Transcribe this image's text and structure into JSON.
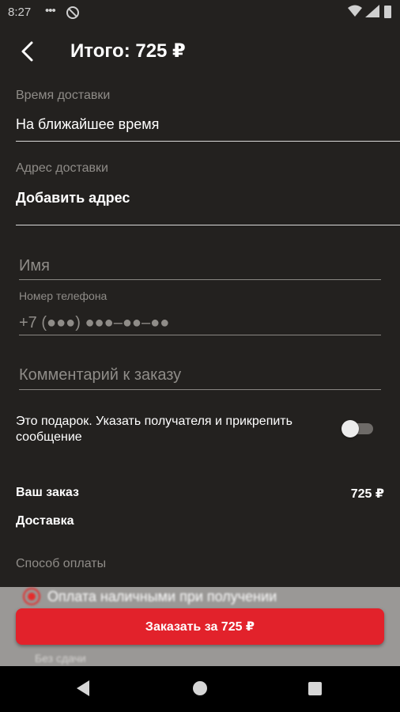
{
  "status_bar": {
    "time": "8:27",
    "dots": "•••",
    "icons": [
      "do-not-disturb-icon",
      "wifi-icon",
      "signal-icon",
      "battery-icon"
    ]
  },
  "header": {
    "title": "Итого: 725 ₽",
    "back_icon": "chevron-left-icon"
  },
  "delivery_time": {
    "label": "Время доставки",
    "value": "На ближайшее время"
  },
  "delivery_address": {
    "label": "Адрес доставки",
    "action": "Добавить адрес"
  },
  "form": {
    "name_placeholder": "Имя",
    "phone_label": "Номер телефона",
    "phone_placeholder": "+7 (●●●) ●●●–●●–●●",
    "comment_placeholder": "Комментарий к заказу"
  },
  "gift": {
    "text": "Это подарок. Указать получателя и прикрепить сообщение",
    "enabled": false
  },
  "summary": {
    "order_label": "Ваш заказ",
    "order_total": "725 ₽",
    "delivery_label": "Доставка",
    "payment_label": "Способ оплаты"
  },
  "payment": {
    "cash_option": "Оплата наличными при получении",
    "no_change": "Без сдачи",
    "selected": true
  },
  "order_button": {
    "label": "Заказать за 725 ₽"
  },
  "colors": {
    "background": "#23211f",
    "accent": "#e2222b",
    "muted_text": "#8f8c88"
  },
  "nav_bar": {
    "icons": [
      "nav-back-icon",
      "nav-home-icon",
      "nav-recents-icon"
    ]
  }
}
